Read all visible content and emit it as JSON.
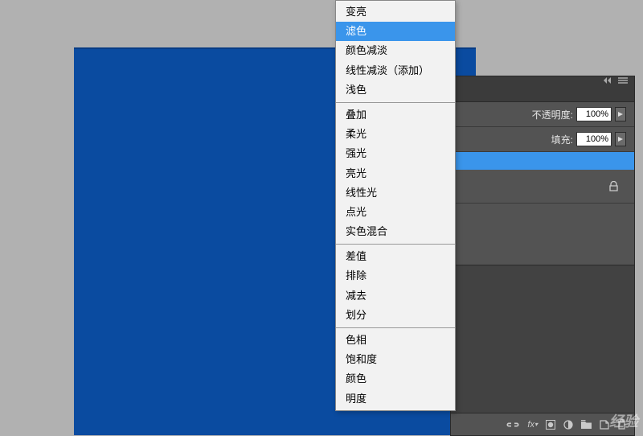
{
  "canvas": {
    "fill": "#0a4ba0"
  },
  "panel": {
    "opacity_label": "不透明度:",
    "opacity_value": "100%",
    "fill_label": "填充:",
    "fill_value": "100%"
  },
  "footer_icons": [
    "link",
    "fx",
    "mask",
    "adjust",
    "folder",
    "new",
    "trash"
  ],
  "menu": {
    "groups": [
      [
        "变亮",
        "滤色",
        "颜色减淡",
        "线性减淡（添加）",
        "浅色"
      ],
      [
        "叠加",
        "柔光",
        "强光",
        "亮光",
        "线性光",
        "点光",
        "实色混合"
      ],
      [
        "差值",
        "排除",
        "减去",
        "划分"
      ],
      [
        "色相",
        "饱和度",
        "颜色",
        "明度"
      ]
    ],
    "selected": "滤色"
  },
  "watermark": "经验"
}
